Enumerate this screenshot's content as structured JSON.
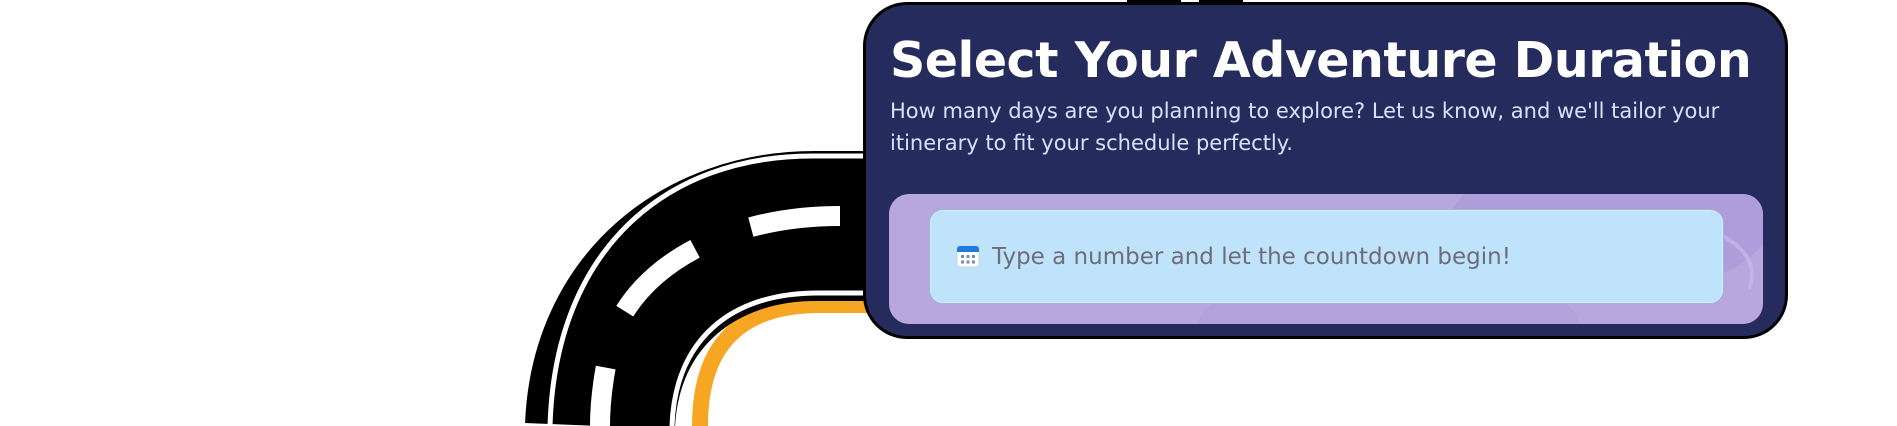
{
  "card": {
    "title": "Select Your Adventure Duration",
    "subtitle": "How many days are you planning to explore? Let us know, and we'll tailor your itinerary to fit your schedule perfectly.",
    "input": {
      "placeholder": "Type a number and let the countdown begin!",
      "value": "",
      "icon": "calendar-icon"
    }
  },
  "colors": {
    "card_background": "#252b5c",
    "panel_background": "#b7a7dd",
    "input_background": "#bfe3fb",
    "road": "#000000",
    "road_edge": "#f6a623"
  }
}
